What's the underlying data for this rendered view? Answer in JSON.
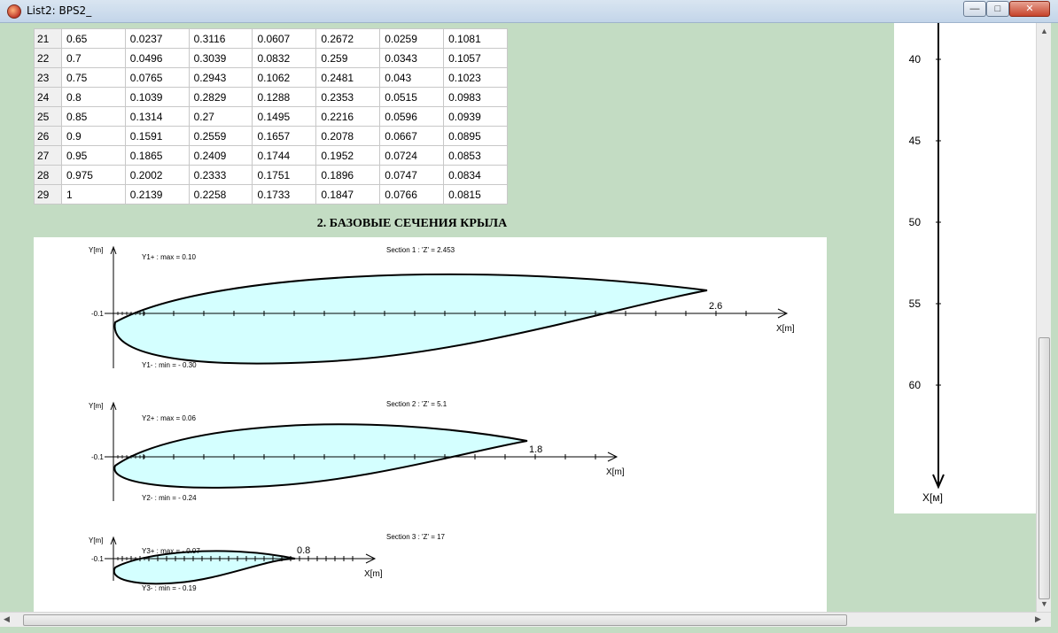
{
  "window": {
    "title": "List2: BPS2_"
  },
  "table": {
    "rows": [
      [
        "21",
        "0.65",
        "0.0237",
        "0.3116",
        "0.0607",
        "0.2672",
        "0.0259",
        "0.1081"
      ],
      [
        "22",
        "0.7",
        "0.0496",
        "0.3039",
        "0.0832",
        "0.259",
        "0.0343",
        "0.1057"
      ],
      [
        "23",
        "0.75",
        "0.0765",
        "0.2943",
        "0.1062",
        "0.2481",
        "0.043",
        "0.1023"
      ],
      [
        "24",
        "0.8",
        "0.1039",
        "0.2829",
        "0.1288",
        "0.2353",
        "0.0515",
        "0.0983"
      ],
      [
        "25",
        "0.85",
        "0.1314",
        "0.27",
        "0.1495",
        "0.2216",
        "0.0596",
        "0.0939"
      ],
      [
        "26",
        "0.9",
        "0.1591",
        "0.2559",
        "0.1657",
        "0.2078",
        "0.0667",
        "0.0895"
      ],
      [
        "27",
        "0.95",
        "0.1865",
        "0.2409",
        "0.1744",
        "0.1952",
        "0.0724",
        "0.0853"
      ],
      [
        "28",
        "0.975",
        "0.2002",
        "0.2333",
        "0.1751",
        "0.1896",
        "0.0747",
        "0.0834"
      ],
      [
        "29",
        "1",
        "0.2139",
        "0.2258",
        "0.1733",
        "0.1847",
        "0.0766",
        "0.0815"
      ]
    ]
  },
  "heading": "2. БАЗОВЫЕ СЕЧЕНИЯ КРЫЛА",
  "sections": [
    {
      "ylabel": "Y[m]",
      "xlabel": "X[m]",
      "title": "Section 1 : 'Z' = 2.453",
      "ymax_label": "Y1+ : max = 0.10",
      "ymin_label": "Y1- : min = - 0.30",
      "axis_value": "-0.1",
      "chord_label": "2.6",
      "chord": 2.6
    },
    {
      "ylabel": "Y[m]",
      "xlabel": "X[m]",
      "title": "Section 2 : 'Z' = 5.1",
      "ymax_label": "Y2+ : max = 0.06",
      "ymin_label": "Y2- : min = - 0.24",
      "axis_value": "-0.1",
      "chord_label": "1.8",
      "chord": 1.8
    },
    {
      "ylabel": "Y[m]",
      "xlabel": "X[m]",
      "title": "Section 3 : 'Z' = 17",
      "ymax_label": "Y3+ : max = - 0.07",
      "ymin_label": "Y3- : min = - 0.19",
      "axis_value": "-0.1",
      "chord_label": "0.8",
      "chord": 0.8
    }
  ],
  "right_axis": {
    "ticks": [
      "40",
      "45",
      "50",
      "55",
      "60"
    ],
    "label": "X[м]"
  },
  "colors": {
    "profile_fill": "#d4ffff",
    "background": "#c3dcc3"
  }
}
